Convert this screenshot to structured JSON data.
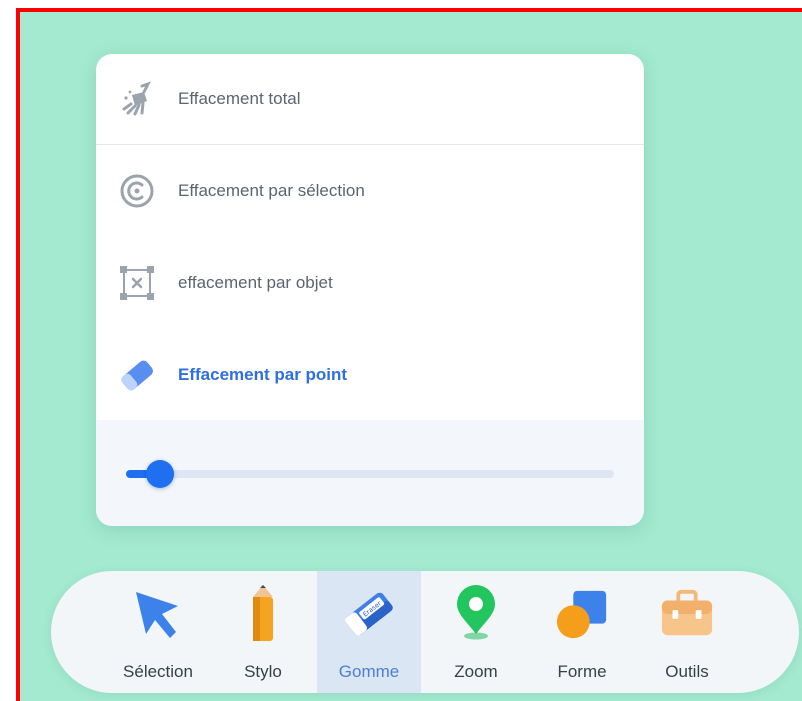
{
  "eraser_menu": {
    "items": [
      {
        "label": "Effacement total",
        "icon": "broom-icon"
      },
      {
        "label": "Effacement par sélection",
        "icon": "lasso-icon"
      },
      {
        "label": "effacement par objet",
        "icon": "object-box-icon"
      },
      {
        "label": "Effacement par point",
        "icon": "eraser-icon",
        "selected": true
      }
    ],
    "size_slider": {
      "value": 0.07
    }
  },
  "toolbar": {
    "tools": [
      {
        "label": "Sélection",
        "icon": "cursor-arrow-icon"
      },
      {
        "label": "Stylo",
        "icon": "pencil-icon"
      },
      {
        "label": "Gomme",
        "icon": "eraser-icon",
        "active": true,
        "icon_text": "Eraser"
      },
      {
        "label": "Zoom",
        "icon": "map-pin-icon"
      },
      {
        "label": "Forme",
        "icon": "shapes-icon"
      },
      {
        "label": "Outils",
        "icon": "toolbox-icon"
      }
    ]
  },
  "colors": {
    "background": "#a3ead0",
    "accent": "#2f6fe0",
    "frame_border": "#ff0000"
  }
}
